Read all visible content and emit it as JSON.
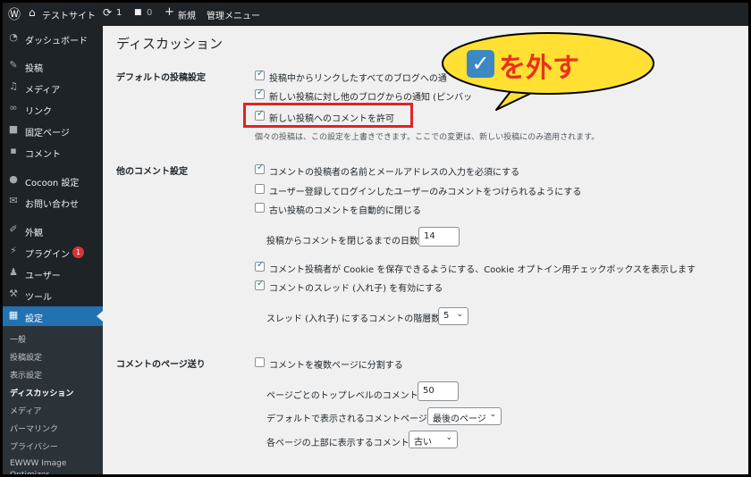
{
  "adminbar": {
    "site": "テストサイト",
    "updates": "1",
    "comments": "0",
    "new": "新規",
    "admin_menu": "管理メニュー"
  },
  "sidebar": {
    "items": [
      {
        "label": "ダッシュボード",
        "icon": "dashboard-icon"
      },
      {
        "label": "投稿",
        "icon": "pin-icon"
      },
      {
        "label": "メディア",
        "icon": "media-icon"
      },
      {
        "label": "リンク",
        "icon": "link-icon"
      },
      {
        "label": "固定ページ",
        "icon": "page-icon"
      },
      {
        "label": "コメント",
        "icon": "comment-icon"
      },
      {
        "label": "Cocoon 設定",
        "icon": "circle-icon"
      },
      {
        "label": "お問い合わせ",
        "icon": "mail-icon"
      },
      {
        "label": "外観",
        "icon": "brush-icon"
      },
      {
        "label": "プラグイン",
        "icon": "plugin-icon",
        "badge": "1"
      },
      {
        "label": "ユーザー",
        "icon": "user-icon"
      },
      {
        "label": "ツール",
        "icon": "wrench-icon"
      },
      {
        "label": "設定",
        "icon": "settings-icon"
      }
    ],
    "submenu": [
      "一般",
      "投稿設定",
      "表示設定",
      "ディスカッション",
      "メディア",
      "パーマリンク",
      "プライバシー",
      "EWWW Image Optimizer"
    ],
    "current_submenu": "ディスカッション"
  },
  "main": {
    "title": "ディスカッション",
    "sections": {
      "default": {
        "label": "デフォルトの投稿設定",
        "options": [
          "投稿中からリンクしたすべてのブログへの通",
          "新しい投稿に対し他のブログからの通知 (ピンバッ",
          "新しい投稿へのコメントを許可"
        ],
        "note": "個々の投稿は、この設定を上書きできます。ここでの変更は、新しい投稿にのみ適用されます。"
      },
      "other": {
        "label": "他のコメント設定",
        "options": [
          "コメントの投稿者の名前とメールアドレスの入力を必須にする",
          "ユーザー登録してログインしたユーザーのみコメントをつけられるようにする",
          "古い投稿のコメントを自動的に閉じる"
        ],
        "close_days_label": "投稿からコメントを閉じるまでの日数",
        "close_days_value": "14",
        "options2": [
          "コメント投稿者が Cookie を保存できるようにする、Cookie オプトイン用チェックボックスを表示します",
          "コメントのスレッド (入れ子) を有効にする"
        ],
        "thread_depth_label": "スレッド (入れ子) にするコメントの階層数",
        "thread_depth_value": "5"
      },
      "paging": {
        "label": "コメントのページ送り",
        "option": "コメントを複数ページに分割する",
        "per_page_label": "ページごとのトップレベルのコメント",
        "per_page_value": "50",
        "default_page_label": "デフォルトで表示されるコメントページ",
        "default_page_value": "最後のページ",
        "order_label": "各ページの上部に表示するコメント",
        "order_value": "古い"
      }
    }
  },
  "callout": {
    "text": "を外す"
  },
  "colors": {
    "accent": "#2271b1",
    "callout_fill": "#ffe033",
    "callout_text": "#e8331c",
    "highlight_box": "#e02424",
    "sidebar_bg": "#1d2327"
  }
}
